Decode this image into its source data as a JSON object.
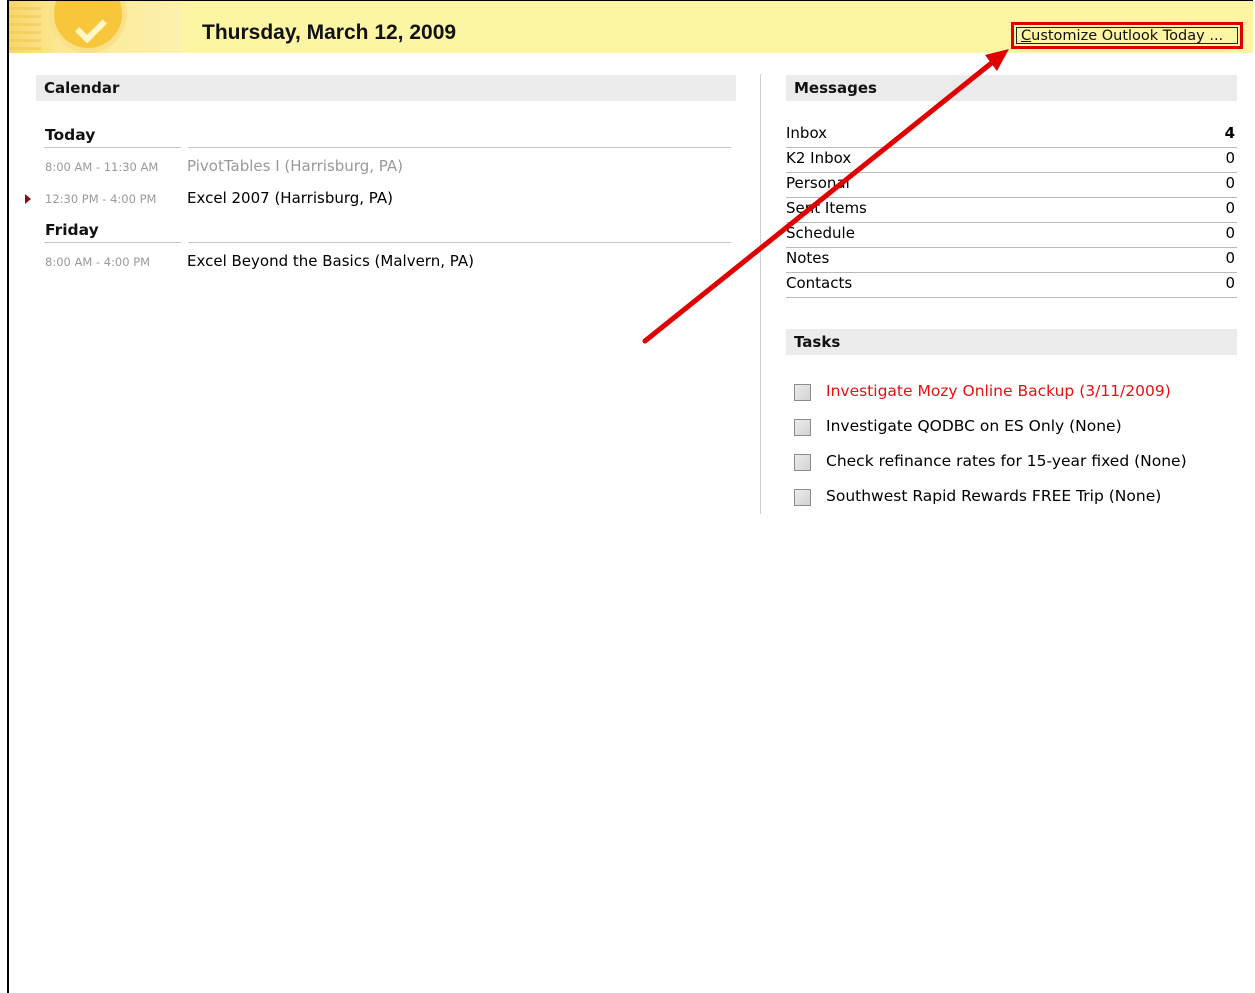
{
  "header": {
    "date": "Thursday, March 12, 2009",
    "customize_label": "Customize Outlook Today ...",
    "logo_icon": "outlook-check-icon",
    "background_color": "#fbf5a4"
  },
  "calendar": {
    "title": "Calendar",
    "days": [
      {
        "label": "Today",
        "appointments": [
          {
            "time": "8:00 AM - 11:30 AM",
            "subject": "PivotTables I (Harrisburg, PA)",
            "state": "past"
          },
          {
            "time": "12:30 PM - 4:00 PM",
            "subject": "Excel 2007 (Harrisburg, PA)",
            "state": "current"
          }
        ]
      },
      {
        "label": "Friday",
        "appointments": [
          {
            "time": "8:00 AM - 4:00 PM",
            "subject": "Excel Beyond the Basics (Malvern, PA)",
            "state": "upcoming"
          }
        ]
      }
    ]
  },
  "messages": {
    "title": "Messages",
    "folders": [
      {
        "name": "Inbox",
        "count": "4",
        "bold": true
      },
      {
        "name": "K2 Inbox",
        "count": "0"
      },
      {
        "name": "Personal",
        "count": "0"
      },
      {
        "name": "Sent Items",
        "count": "0"
      },
      {
        "name": "Schedule",
        "count": "0"
      },
      {
        "name": "Notes",
        "count": "0"
      },
      {
        "name": "Contacts",
        "count": "0"
      }
    ]
  },
  "tasks": {
    "title": "Tasks",
    "items": [
      {
        "label": "Investigate Mozy Online Backup (3/11/2009)",
        "overdue": true,
        "checked": false
      },
      {
        "label": "Investigate QODBC on ES Only (None)",
        "overdue": false,
        "checked": false
      },
      {
        "label": "Check refinance rates for 15-year fixed (None)",
        "overdue": false,
        "checked": false
      },
      {
        "label": "Southwest Rapid Rewards FREE Trip (None)",
        "overdue": false,
        "checked": false
      }
    ]
  },
  "colors": {
    "annotation_red": "#e00000",
    "overdue_red": "#e81010",
    "section_gray": "#ebebeb"
  }
}
